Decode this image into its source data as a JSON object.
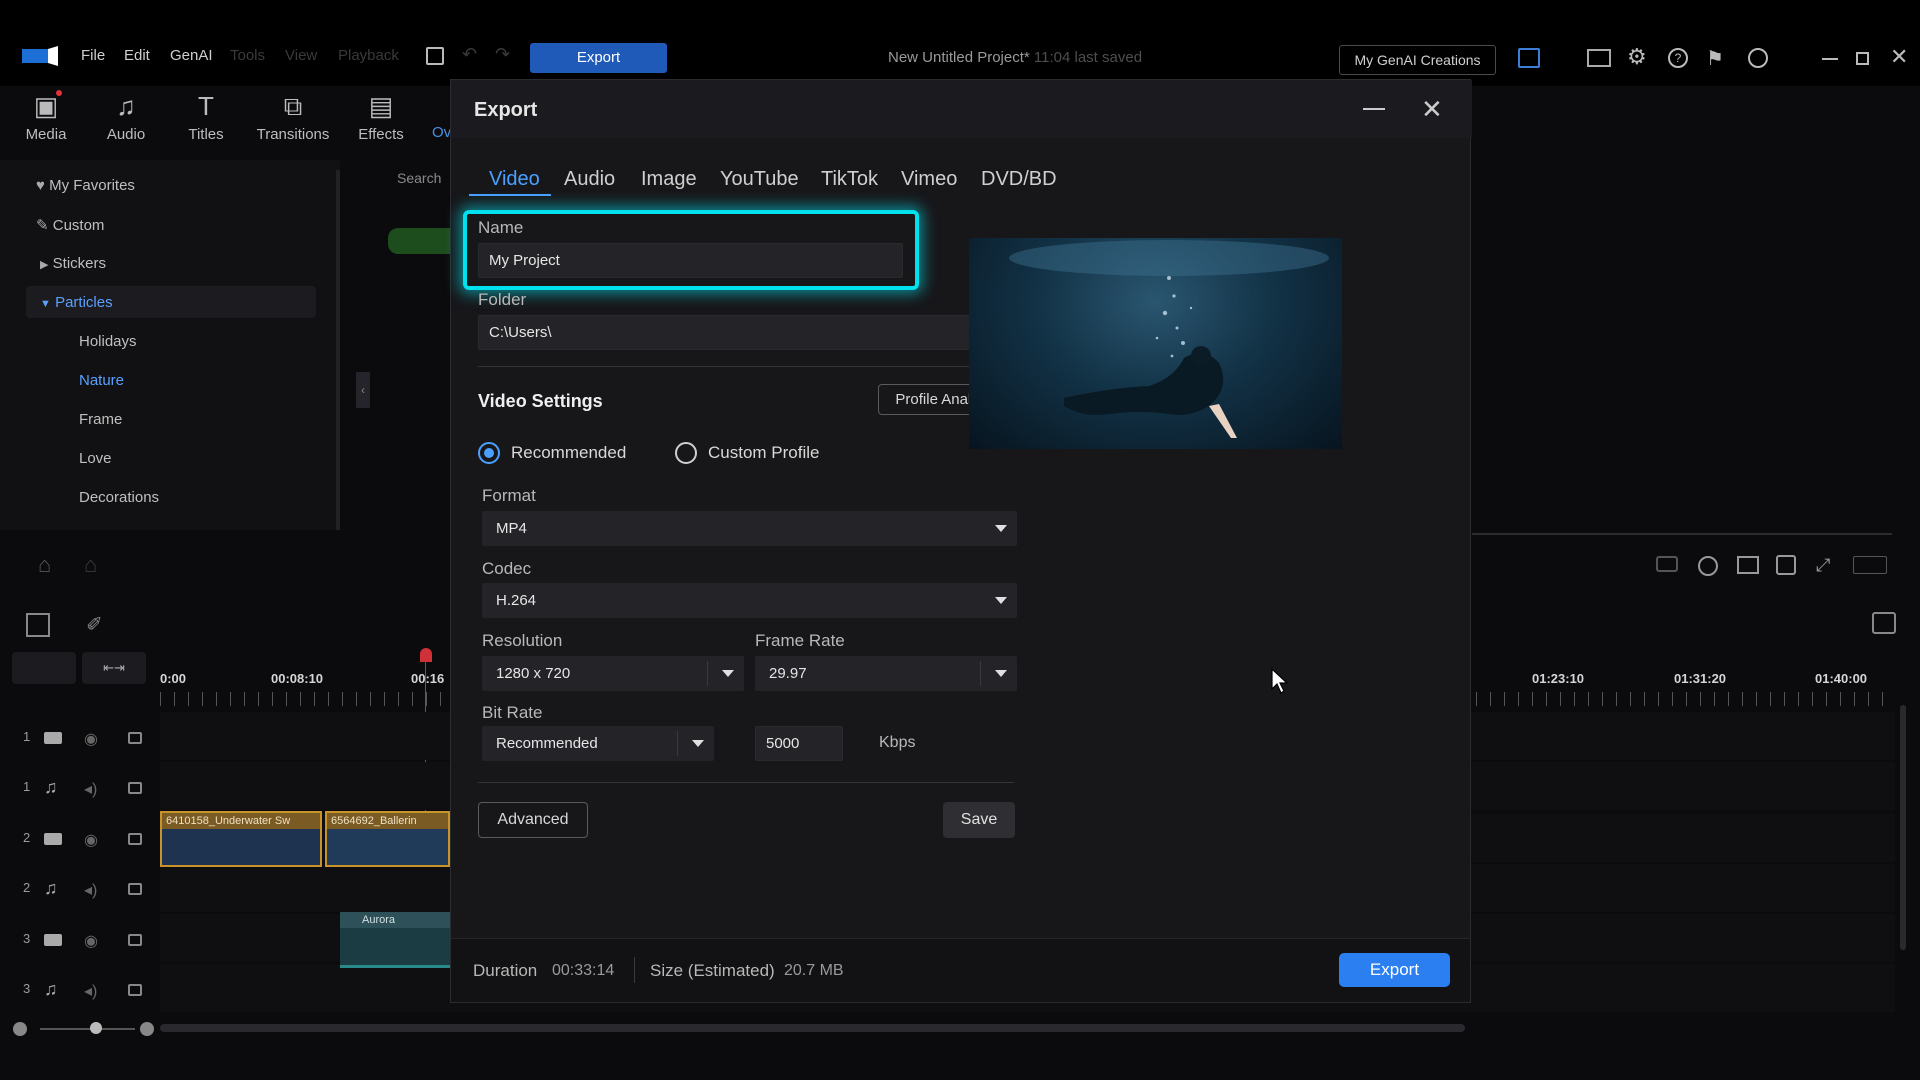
{
  "menu": {
    "items": [
      "File",
      "Edit",
      "GenAI",
      "Tools",
      "View",
      "Playback"
    ],
    "export_label": "Export",
    "project_title": "New Untitled Project*",
    "last_saved": "11:04 last saved",
    "genai_button": "My GenAI Creations"
  },
  "library": {
    "tabs": [
      "Media",
      "Audio",
      "Titles",
      "Transitions",
      "Effects"
    ],
    "partial_tab": "Ov",
    "search_partial": "Search",
    "sidebar": {
      "favorites": "My Favorites",
      "custom": "Custom",
      "stickers": "Stickers",
      "particles": "Particles",
      "children": [
        "Holidays",
        "Nature",
        "Frame",
        "Love",
        "Decorations"
      ],
      "active_child": "Nature"
    }
  },
  "timeline": {
    "ruler_labels": [
      "0:00",
      "00:08:10",
      "00:16",
      "01:23:10",
      "01:31:20",
      "01:40:00"
    ],
    "track_numbers": [
      "1",
      "1",
      "2",
      "2",
      "3",
      "3"
    ],
    "clips": {
      "clip1": "6410158_Underwater Sw",
      "clip2": "6564692_Ballerin",
      "clip3": "Aurora"
    }
  },
  "dialog": {
    "title": "Export",
    "tabs": [
      "Video",
      "Audio",
      "Image",
      "YouTube",
      "TikTok",
      "Vimeo",
      "DVD/BD"
    ],
    "active_tab": "Video",
    "name_label": "Name",
    "name_value": "My Project",
    "folder_label": "Folder",
    "folder_value": "C:\\Users\\",
    "video_settings_title": "Video Settings",
    "profile_analyzer": "Profile Analyzer",
    "recommended_label": "Recommended",
    "custom_profile_label": "Custom Profile",
    "format_label": "Format",
    "format_value": "MP4",
    "codec_label": "Codec",
    "codec_value": "H.264",
    "resolution_label": "Resolution",
    "resolution_value": "1280 x 720",
    "frame_rate_label": "Frame Rate",
    "frame_rate_value": "29.97",
    "bit_rate_label": "Bit Rate",
    "bit_rate_mode": "Recommended",
    "bit_rate_value": "5000",
    "bit_rate_unit": "Kbps",
    "advanced_label": "Advanced",
    "save_label": "Save",
    "duration_label": "Duration",
    "duration_value": "00:33:14",
    "size_label": "Size (Estimated)",
    "size_value": "20.7 MB",
    "export_label": "Export"
  },
  "colors": {
    "accent": "#2b7ff0",
    "highlight": "#00e1ee"
  }
}
